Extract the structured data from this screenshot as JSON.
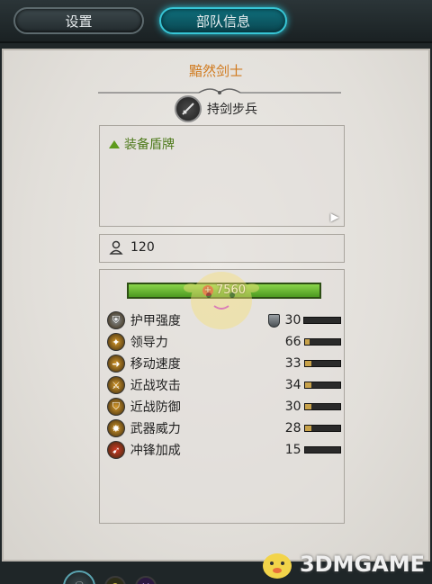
{
  "tabs": [
    {
      "label": "设置"
    },
    {
      "label": "部队信息"
    }
  ],
  "unit": {
    "name": "黯然剑士",
    "type_label": "持剑步兵",
    "ability": "装备盾牌",
    "men": "120",
    "hp": "7560"
  },
  "stats": [
    {
      "label": "护甲强度",
      "value": "30",
      "bar": 0.0,
      "icon": "armor-icon",
      "color": "#8a8f93"
    },
    {
      "label": "领导力",
      "value": "66",
      "bar": 0.15,
      "icon": "leadership-icon",
      "color": "#d89a2a"
    },
    {
      "label": "移动速度",
      "value": "33",
      "bar": 0.18,
      "icon": "speed-icon",
      "color": "#d89a2a"
    },
    {
      "label": "近战攻击",
      "value": "34",
      "bar": 0.18,
      "icon": "melee-attack-icon",
      "color": "#d89a2a"
    },
    {
      "label": "近战防御",
      "value": "30",
      "bar": 0.18,
      "icon": "melee-defence-icon",
      "color": "#d89a2a"
    },
    {
      "label": "武器威力",
      "value": "28",
      "bar": 0.18,
      "icon": "weapon-strength-icon",
      "color": "#d89a2a"
    },
    {
      "label": "冲锋加成",
      "value": "15",
      "bar": 0.0,
      "icon": "charge-bonus-icon",
      "color": "#d63a26"
    }
  ],
  "watermark": "3DMGAME"
}
